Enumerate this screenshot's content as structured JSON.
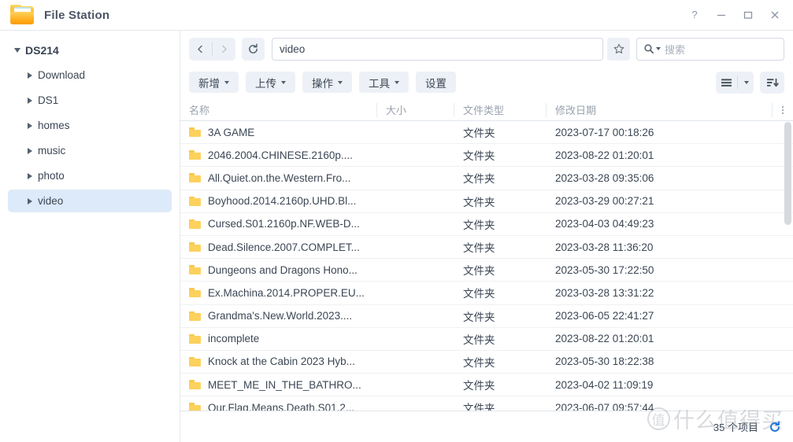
{
  "window": {
    "title": "File Station",
    "app_icon": "folder-icon",
    "buttons": {
      "help": "?",
      "minimize": "minimize-icon",
      "maximize": "maximize-icon",
      "close": "close-icon"
    }
  },
  "sidebar": {
    "root": {
      "label": "DS214",
      "expanded": true
    },
    "items": [
      {
        "label": "Download",
        "selected": false
      },
      {
        "label": "DS1",
        "selected": false
      },
      {
        "label": "homes",
        "selected": false
      },
      {
        "label": "music",
        "selected": false
      },
      {
        "label": "photo",
        "selected": false
      },
      {
        "label": "video",
        "selected": true
      }
    ]
  },
  "nav": {
    "back": "back-icon",
    "forward": "forward-icon",
    "refresh": "refresh-icon",
    "path_value": "video",
    "favorite": "star-icon",
    "search_icon": "search-icon",
    "search_placeholder": "搜索",
    "search_value": ""
  },
  "toolbar": {
    "buttons": [
      {
        "label": "新增",
        "has_caret": true
      },
      {
        "label": "上传",
        "has_caret": true
      },
      {
        "label": "操作",
        "has_caret": true
      },
      {
        "label": "工具",
        "has_caret": true
      },
      {
        "label": "设置",
        "has_caret": false
      }
    ],
    "view_mode": "list-view-icon",
    "view_caret": "chevron-down-icon",
    "sort": "sort-descending-icon"
  },
  "table": {
    "columns": [
      "名称",
      "大小",
      "文件类型",
      "修改日期"
    ],
    "column_menu": "more-options-icon",
    "rows": [
      {
        "name": "3A GAME",
        "size": "",
        "type": "文件夹",
        "date": "2023-07-17 00:18:26"
      },
      {
        "name": "2046.2004.CHINESE.2160p....",
        "size": "",
        "type": "文件夹",
        "date": "2023-08-22 01:20:01"
      },
      {
        "name": "All.Quiet.on.the.Western.Fro...",
        "size": "",
        "type": "文件夹",
        "date": "2023-03-28 09:35:06"
      },
      {
        "name": "Boyhood.2014.2160p.UHD.Bl...",
        "size": "",
        "type": "文件夹",
        "date": "2023-03-29 00:27:21"
      },
      {
        "name": "Cursed.S01.2160p.NF.WEB-D...",
        "size": "",
        "type": "文件夹",
        "date": "2023-04-03 04:49:23"
      },
      {
        "name": "Dead.Silence.2007.COMPLET...",
        "size": "",
        "type": "文件夹",
        "date": "2023-03-28 11:36:20"
      },
      {
        "name": "Dungeons and Dragons Hono...",
        "size": "",
        "type": "文件夹",
        "date": "2023-05-30 17:22:50"
      },
      {
        "name": "Ex.Machina.2014.PROPER.EU...",
        "size": "",
        "type": "文件夹",
        "date": "2023-03-28 13:31:22"
      },
      {
        "name": "Grandma's.New.World.2023....",
        "size": "",
        "type": "文件夹",
        "date": "2023-06-05 22:41:27"
      },
      {
        "name": "incomplete",
        "size": "",
        "type": "文件夹",
        "date": "2023-08-22 01:20:01"
      },
      {
        "name": "Knock at the Cabin 2023 Hyb...",
        "size": "",
        "type": "文件夹",
        "date": "2023-05-30 18:22:38"
      },
      {
        "name": "MEET_ME_IN_THE_BATHRO...",
        "size": "",
        "type": "文件夹",
        "date": "2023-04-02 11:09:19"
      },
      {
        "name": "Our.Flag.Means.Death.S01.2...",
        "size": "",
        "type": "文件夹",
        "date": "2023-06-07 09:57:44"
      }
    ]
  },
  "status": {
    "count_text": "35 个项目",
    "refresh_icon": "refresh-icon"
  },
  "watermark": {
    "badge": "值",
    "text": "什么值得买"
  },
  "colors": {
    "accent": "#1e77e0",
    "selection": "#ddeaf9",
    "button_bg": "#edf1f7",
    "folder": "#fcd15c",
    "text": "#3b4654"
  }
}
